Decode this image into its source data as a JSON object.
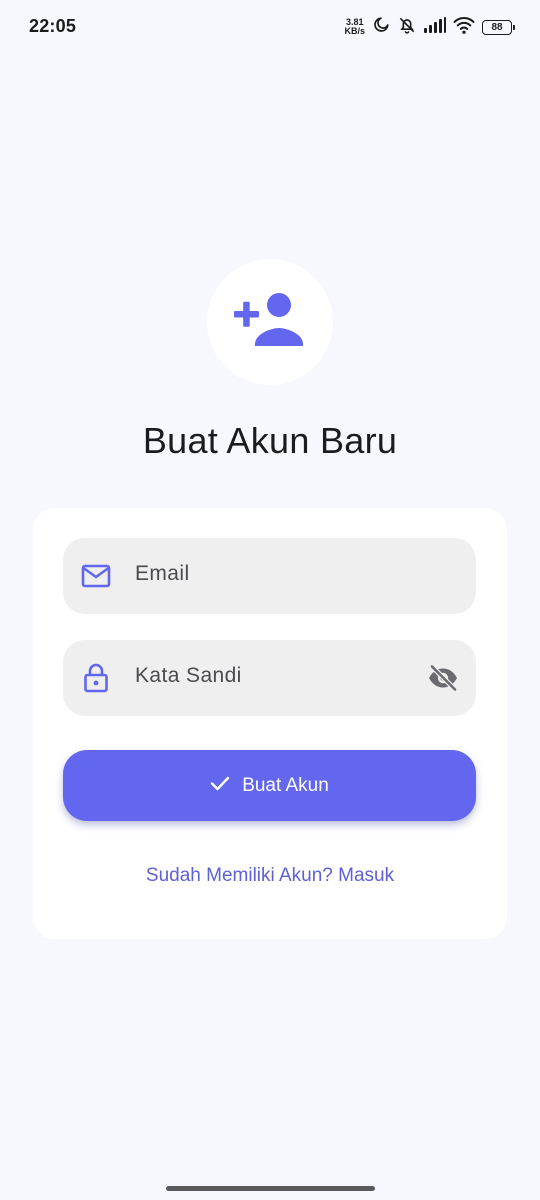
{
  "status_bar": {
    "time": "22:05",
    "net_speed_value": "3.81",
    "net_speed_unit": "KB/s",
    "battery": "88",
    "icons": [
      "moon-icon",
      "mute-icon",
      "signal-icon",
      "wifi-icon",
      "battery-icon"
    ]
  },
  "header": {
    "icon": "person-add-icon",
    "title": "Buat Akun Baru"
  },
  "form": {
    "email": {
      "icon": "mail-icon",
      "placeholder": "Email",
      "value": ""
    },
    "password": {
      "icon": "lock-icon",
      "placeholder": "Kata Sandi",
      "value": "",
      "toggle_icon": "eye-off-icon"
    },
    "submit": {
      "icon": "check-icon",
      "label": "Buat Akun"
    },
    "login_link": "Sudah Memiliki Akun? Masuk"
  },
  "colors": {
    "accent": "#6366ee",
    "background": "#f7f8fd",
    "card": "#ffffff",
    "field": "#efeff0",
    "link": "#5e60d6"
  }
}
